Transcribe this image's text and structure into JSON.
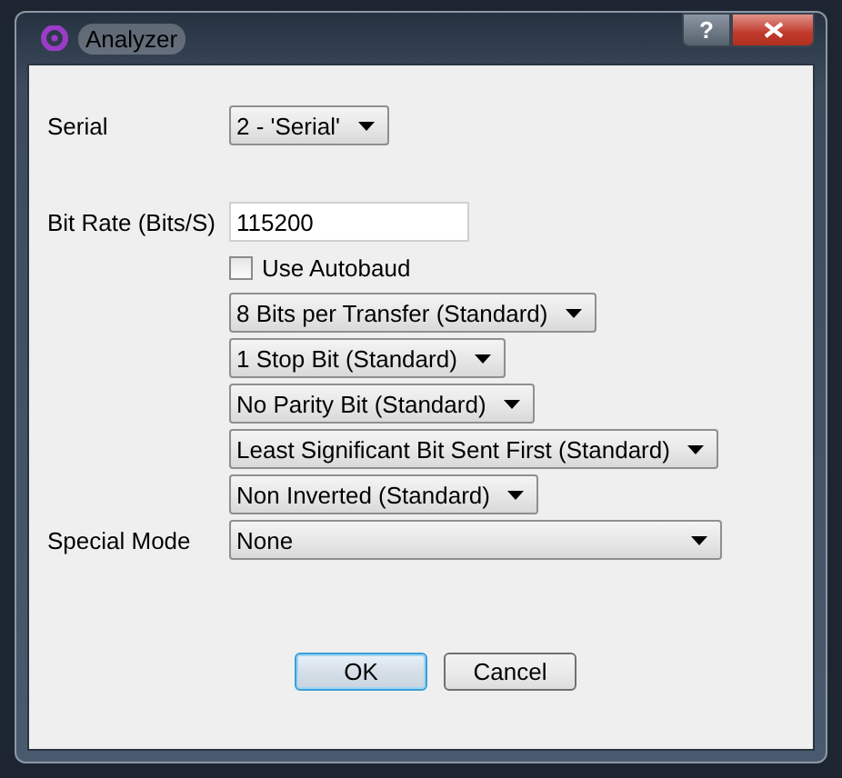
{
  "window": {
    "title": "Analyzer",
    "help_button": "?"
  },
  "fields": [
    {
      "kind": "combo",
      "label": "Serial",
      "value": "2 - 'Serial'"
    },
    {
      "kind": "input",
      "label": "Bit Rate (Bits/S)",
      "value": "115200"
    },
    {
      "kind": "checkbox",
      "text": "Use Autobaud",
      "checked": false
    },
    {
      "kind": "combo",
      "value": "8 Bits per Transfer (Standard)"
    },
    {
      "kind": "combo",
      "value": "1 Stop Bit (Standard)"
    },
    {
      "kind": "combo",
      "value": "No Parity Bit (Standard)"
    },
    {
      "kind": "combo",
      "value": "Least Significant Bit Sent First (Standard)"
    },
    {
      "kind": "combo",
      "value": "Non Inverted (Standard)"
    },
    {
      "kind": "combo",
      "label": "Special Mode",
      "value": "None"
    }
  ],
  "buttons": [
    {
      "label": "OK",
      "default": true
    },
    {
      "label": "Cancel",
      "default": false
    }
  ]
}
